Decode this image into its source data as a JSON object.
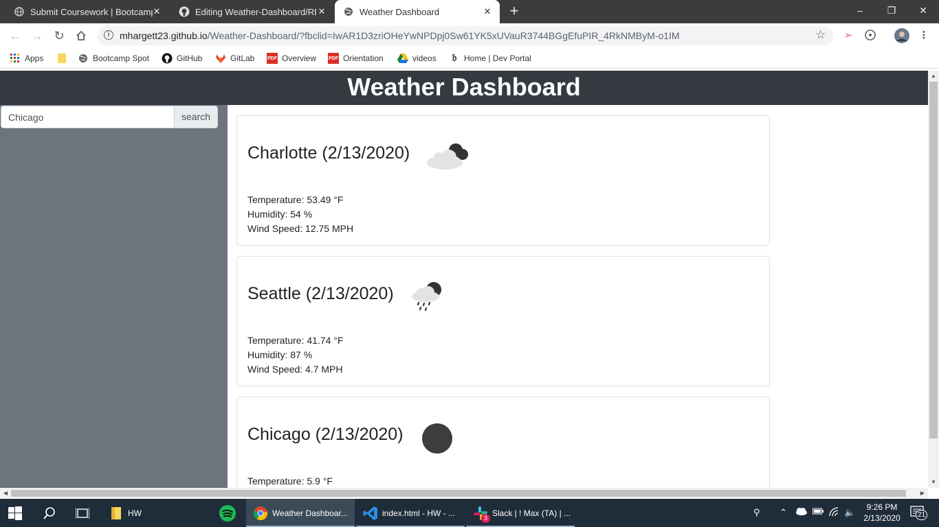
{
  "browser": {
    "tabs": [
      {
        "title": "Submit Coursework | Bootcamp S",
        "close": "✕"
      },
      {
        "title": "Editing Weather-Dashboard/REA",
        "close": "✕"
      },
      {
        "title": "Weather Dashboard",
        "close": "✕"
      }
    ],
    "new_tab": "+",
    "url_host": "mhargett23.github.io",
    "url_path": "/Weather-Dashboard/?fbclid=IwAR1D3zriOHeYwNPDpj0Sw61YK5xUVauR3744BGgEfuPIR_4RkNMByM-o1IM",
    "bookmarks": [
      "Apps",
      "",
      "Bootcamp Spot",
      "GitHub",
      "GitLab",
      "Overview",
      "Orientation",
      "videos",
      "Home | Dev Portal"
    ],
    "pdf_label": "PDF"
  },
  "page": {
    "header_title": "Weather Dashboard",
    "search": {
      "value": "Chicago",
      "button": "search"
    },
    "cards": [
      {
        "city": "Charlotte (2/13/2020)",
        "icon": "cloudy-night-icon",
        "temperature": "Temperature: 53.49 °F",
        "humidity": "Humidity: 54 %",
        "wind": "Wind Speed: 12.75 MPH"
      },
      {
        "city": "Seattle (2/13/2020)",
        "icon": "rain-night-icon",
        "temperature": "Temperature: 41.74 °F",
        "humidity": "Humidity: 87 %",
        "wind": "Wind Speed: 4.7 MPH"
      },
      {
        "city": "Chicago (2/13/2020)",
        "icon": "clear-night-icon",
        "temperature": "Temperature: 5.9 °F"
      }
    ]
  },
  "taskbar": {
    "items": [
      "HW",
      "Weather Dashboar...",
      "index.html - HW - ...",
      "Slack | ! Max (TA) | ..."
    ],
    "slack_badge": "3",
    "time": "9:26 PM",
    "date": "2/13/2020",
    "notif_count": "21"
  },
  "colors": {
    "header_bg": "#343a40",
    "sidebar_bg": "#6c757d",
    "taskbar_bg": "#1f2d3a",
    "tabstrip_bg": "#3c3c3c"
  }
}
